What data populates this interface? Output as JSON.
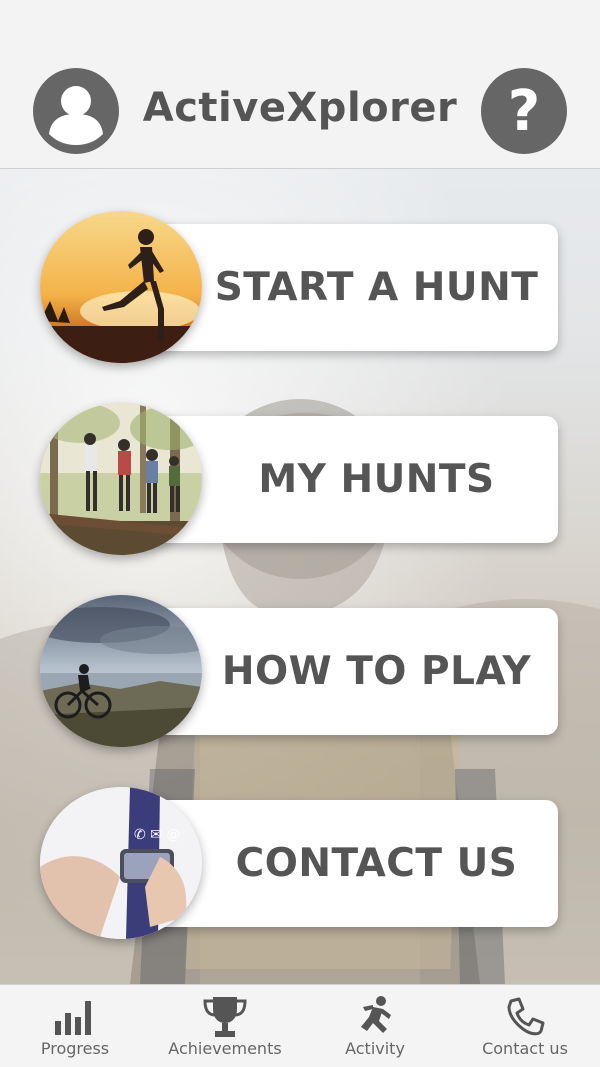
{
  "app": {
    "title": "ActiveXplorer"
  },
  "header": {
    "profile_icon": "user-icon",
    "help_icon": "question-icon"
  },
  "menu": [
    {
      "label": "START A HUNT",
      "image": "runner-sunset-photo"
    },
    {
      "label": "MY HUNTS",
      "image": "friends-forest-photo"
    },
    {
      "label": "HOW TO PLAY",
      "image": "cyclist-coast-photo"
    },
    {
      "label": "CONTACT US",
      "image": "phone-contact-photo"
    }
  ],
  "nav": [
    {
      "label": "Progress",
      "icon": "bar-chart-icon"
    },
    {
      "label": "Achievements",
      "icon": "trophy-icon"
    },
    {
      "label": "Activity",
      "icon": "running-person-icon"
    },
    {
      "label": "Contact us",
      "icon": "phone-icon"
    }
  ],
  "colors": {
    "primary_gray": "#666666",
    "text": "#555555",
    "card": "#ffffff"
  }
}
